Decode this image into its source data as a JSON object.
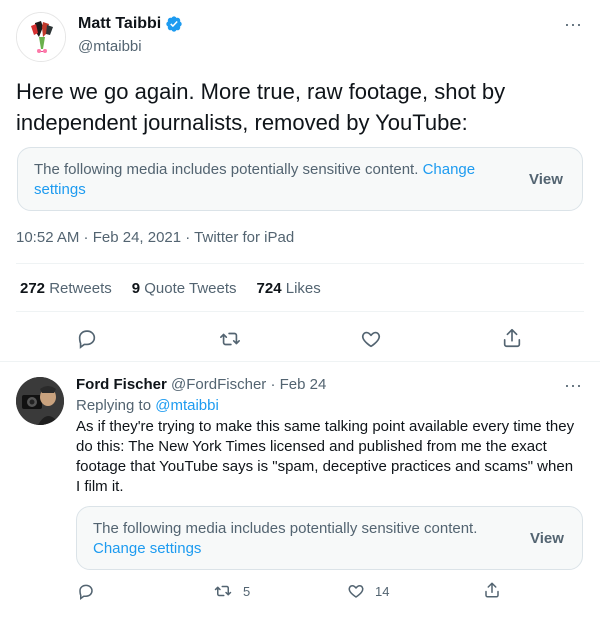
{
  "main_tweet": {
    "author_name": "Matt Taibbi",
    "author_handle": "@mtaibbi",
    "text": "Here we go again. More true, raw footage, shot by independent journalists, removed by YouTube:",
    "sensitive_notice": "The following media includes potentially sensitive content.",
    "change_settings_label": "Change settings",
    "view_label": "View",
    "timestamp": "10:52 AM · Feb 24, 2021 · Twitter for iPad",
    "stats": {
      "retweets_count": "272",
      "retweets_label": "Retweets",
      "quotes_count": "9",
      "quotes_label": "Quote Tweets",
      "likes_count": "724",
      "likes_label": "Likes"
    },
    "icons": [
      "reply-icon",
      "retweet-icon",
      "like-icon",
      "share-icon"
    ]
  },
  "reply_tweet": {
    "author_name": "Ford Fischer",
    "author_handle": "@FordFischer",
    "date": "· Feb 24",
    "replying_label": "Replying to",
    "replying_handle": "@mtaibbi",
    "text": "As if they're trying to make this same talking point available every time they do this: The New York Times licensed and published from me the exact footage that YouTube says is \"spam, deceptive practices and scams\" when I film it.",
    "sensitive_notice": "The following media includes potentially sensitive content.",
    "change_settings_label": "Change settings",
    "view_label": "View",
    "retweet_count": "5",
    "like_count": "14"
  },
  "colors": {
    "accent": "#1d9bf0",
    "text": "#0f1419",
    "secondary": "#536471",
    "divider": "#eff3f4",
    "notice_bg": "#f7f9f9"
  }
}
